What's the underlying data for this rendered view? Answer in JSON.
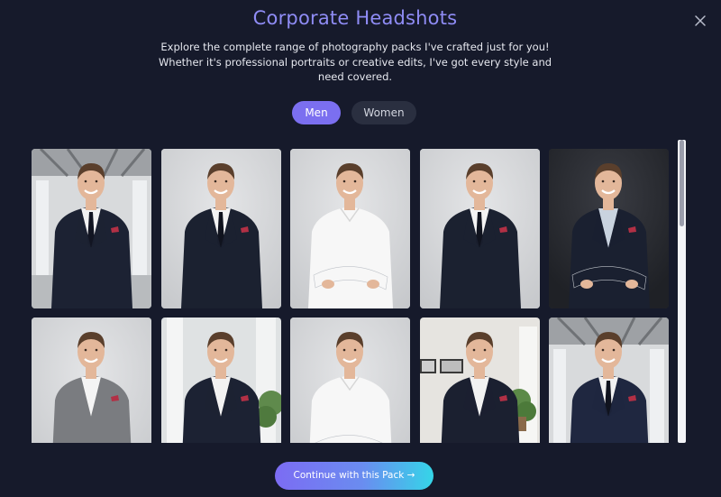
{
  "modal": {
    "title": "Corporate Headshots",
    "subtitle": "Explore the complete range of photography packs I've crafted just for you! Whether it's professional portraits or creative edits, I've got every style and need covered.",
    "close_icon": "close-icon"
  },
  "tabs": [
    {
      "label": "Men",
      "active": true
    },
    {
      "label": "Women",
      "active": false
    }
  ],
  "photos": [
    {
      "bg": "office",
      "suit": "#1c2233",
      "shirt": "#f2f2f2",
      "tie": "#121522",
      "pose": "hands-pockets"
    },
    {
      "bg": "grey",
      "suit": "#1b2130",
      "shirt": "#f4f4f4",
      "tie": "#10131e",
      "pose": "hands-pockets"
    },
    {
      "bg": "grey",
      "suit": "none",
      "shirt": "#f7f7f7",
      "tie": "none",
      "pose": "arms-crossed"
    },
    {
      "bg": "grey",
      "suit": "#1b2130",
      "shirt": "#f4f4f4",
      "tie": "#10131e",
      "pose": "hands-pockets"
    },
    {
      "bg": "dark",
      "suit": "#1a2030",
      "shirt": "#c9d3df",
      "tie": "none",
      "pose": "arms-crossed"
    },
    {
      "bg": "grey",
      "suit": "#7a7c80",
      "shirt": "#f4f4f4",
      "tie": "none",
      "pose": "hands-pockets"
    },
    {
      "bg": "window",
      "suit": "#1c2233",
      "shirt": "#f2f2f2",
      "tie": "none",
      "pose": "hands-pockets"
    },
    {
      "bg": "grey",
      "suit": "none",
      "shirt": "#f7f7f7",
      "tie": "none",
      "pose": "arms-crossed"
    },
    {
      "bg": "gallery",
      "suit": "#1b2030",
      "shirt": "#f2f2f2",
      "tie": "none",
      "pose": "hands-pockets"
    },
    {
      "bg": "office",
      "suit": "#1f2740",
      "shirt": "#f2f2f2",
      "tie": "#10131e",
      "pose": "hands-pockets"
    }
  ],
  "cta": {
    "label": "Continue with this Pack →"
  },
  "colors": {
    "background": "#161a2b",
    "title": "#8f8cf5",
    "tab_active": "#7b6ff0",
    "tab_inactive": "#2a2f40"
  }
}
